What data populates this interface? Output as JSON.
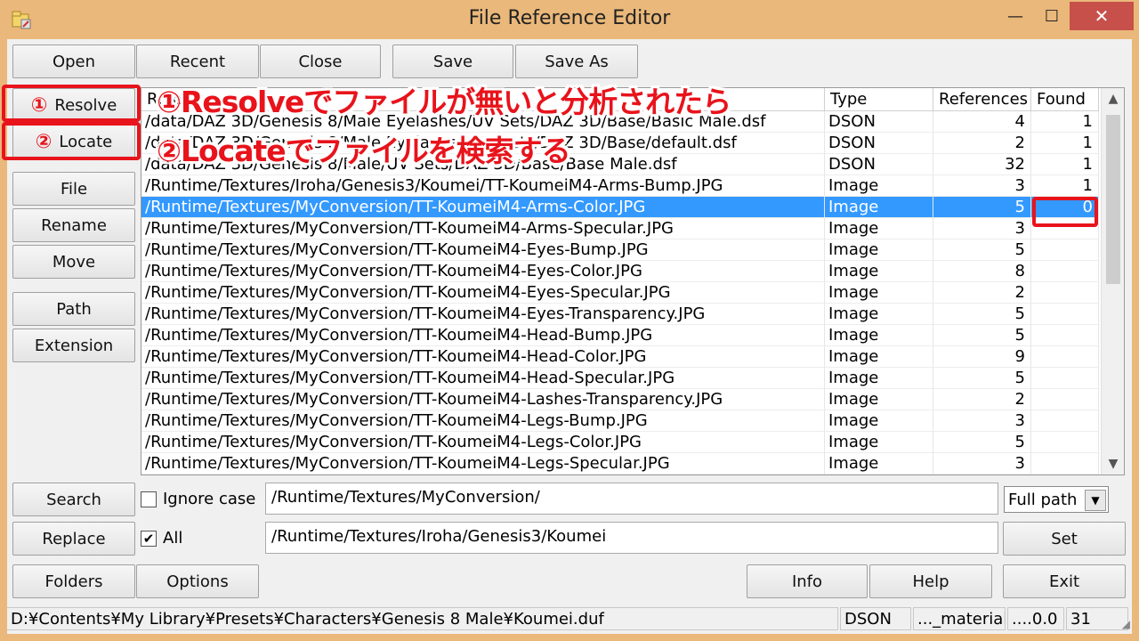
{
  "window": {
    "title": "File Reference Editor",
    "min_glyph": "—",
    "max_glyph": "☐",
    "close_glyph": "✕"
  },
  "toolbar": {
    "open": "Open",
    "recent": "Recent",
    "close": "Close",
    "save": "Save",
    "save_as": "Save As"
  },
  "side": {
    "resolve": "Resolve",
    "locate": "Locate",
    "file": "File",
    "rename": "Rename",
    "move": "Move",
    "path": "Path",
    "extension": "Extension"
  },
  "annotations": {
    "num1": "①",
    "num2": "②",
    "text1": "①Resolveでファイルが無いと分析されたら",
    "text2": "②Locateでファイルを検索する"
  },
  "table": {
    "columns": {
      "reference": "Reference",
      "type": "Type",
      "references": "References",
      "found": "Found"
    },
    "rows": [
      {
        "path": "/data/DAZ 3D/Genesis 8/Male Eyelashes/UV Sets/DAZ 3D/Base/Basic Male.dsf",
        "type": "DSON",
        "refs": "4",
        "found": "1"
      },
      {
        "path": "/data/DAZ 3D/Genesis 8/Male Eyelashes/UV Sets/DAZ 3D/Base/default.dsf",
        "type": "DSON",
        "refs": "2",
        "found": "1"
      },
      {
        "path": "/data/DAZ 3D/Genesis 8/Male/UV Sets/DAZ 3D/Base/Base Male.dsf",
        "type": "DSON",
        "refs": "32",
        "found": "1"
      },
      {
        "path": "/Runtime/Textures/Iroha/Genesis3/Koumei/TT-KoumeiM4-Arms-Bump.JPG",
        "type": "Image",
        "refs": "3",
        "found": "1"
      },
      {
        "path": "/Runtime/Textures/MyConversion/TT-KoumeiM4-Arms-Color.JPG",
        "type": "Image",
        "refs": "5",
        "found": "0"
      },
      {
        "path": "/Runtime/Textures/MyConversion/TT-KoumeiM4-Arms-Specular.JPG",
        "type": "Image",
        "refs": "3",
        "found": ""
      },
      {
        "path": "/Runtime/Textures/MyConversion/TT-KoumeiM4-Eyes-Bump.JPG",
        "type": "Image",
        "refs": "5",
        "found": ""
      },
      {
        "path": "/Runtime/Textures/MyConversion/TT-KoumeiM4-Eyes-Color.JPG",
        "type": "Image",
        "refs": "8",
        "found": ""
      },
      {
        "path": "/Runtime/Textures/MyConversion/TT-KoumeiM4-Eyes-Specular.JPG",
        "type": "Image",
        "refs": "2",
        "found": ""
      },
      {
        "path": "/Runtime/Textures/MyConversion/TT-KoumeiM4-Eyes-Transparency.JPG",
        "type": "Image",
        "refs": "5",
        "found": ""
      },
      {
        "path": "/Runtime/Textures/MyConversion/TT-KoumeiM4-Head-Bump.JPG",
        "type": "Image",
        "refs": "5",
        "found": ""
      },
      {
        "path": "/Runtime/Textures/MyConversion/TT-KoumeiM4-Head-Color.JPG",
        "type": "Image",
        "refs": "9",
        "found": ""
      },
      {
        "path": "/Runtime/Textures/MyConversion/TT-KoumeiM4-Head-Specular.JPG",
        "type": "Image",
        "refs": "5",
        "found": ""
      },
      {
        "path": "/Runtime/Textures/MyConversion/TT-KoumeiM4-Lashes-Transparency.JPG",
        "type": "Image",
        "refs": "2",
        "found": ""
      },
      {
        "path": "/Runtime/Textures/MyConversion/TT-KoumeiM4-Legs-Bump.JPG",
        "type": "Image",
        "refs": "3",
        "found": ""
      },
      {
        "path": "/Runtime/Textures/MyConversion/TT-KoumeiM4-Legs-Color.JPG",
        "type": "Image",
        "refs": "5",
        "found": ""
      },
      {
        "path": "/Runtime/Textures/MyConversion/TT-KoumeiM4-Legs-Specular.JPG",
        "type": "Image",
        "refs": "3",
        "found": ""
      }
    ],
    "selected_index": 4,
    "scroll_up": "▲",
    "scroll_down": "▼"
  },
  "search": {
    "search_button": "Search",
    "replace_button": "Replace",
    "ignore_case_label": "Ignore case",
    "ignore_case_checked": false,
    "all_label": "All",
    "all_checked": true,
    "search_value": "/Runtime/Textures/MyConversion/",
    "replace_value": "/Runtime/Textures/Iroha/Genesis3/Koumei",
    "mode_value": "Full path",
    "set_button": "Set"
  },
  "bottom": {
    "folders": "Folders",
    "options": "Options",
    "info": "Info",
    "help": "Help",
    "exit": "Exit"
  },
  "status": {
    "path": "D:¥Contents¥My Library¥Presets¥Characters¥Genesis 8 Male¥Koumei.duf",
    "type": "DSON",
    "material": "..._material",
    "version": "....0.0",
    "count": "31"
  },
  "colors": {
    "frame": "#eab87a",
    "selection": "#3399ff",
    "highlight": "#e8131b"
  }
}
